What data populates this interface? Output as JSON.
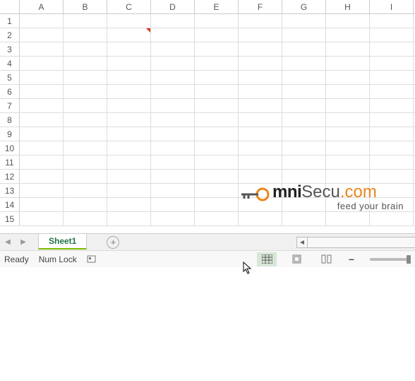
{
  "columns": [
    "A",
    "B",
    "C",
    "D",
    "E",
    "F",
    "G",
    "H",
    "I"
  ],
  "rows": [
    "1",
    "2",
    "3",
    "4",
    "5",
    "6",
    "7",
    "8",
    "9",
    "10",
    "11",
    "12",
    "13",
    "14",
    "15"
  ],
  "comment_cell": {
    "row": 2,
    "col": "C"
  },
  "sheet_tabs": {
    "active": "Sheet1"
  },
  "status": {
    "ready": "Ready",
    "numlock": "Num Lock"
  },
  "watermark": {
    "brand1": "mni",
    "brand2": "Secu",
    "brand3": ".com",
    "tagline": "feed your brain"
  },
  "icons": {
    "prev": "◀",
    "next": "▶",
    "plus": "+",
    "minus": "−",
    "drag": "⋮",
    "scroll_left": "◀"
  }
}
